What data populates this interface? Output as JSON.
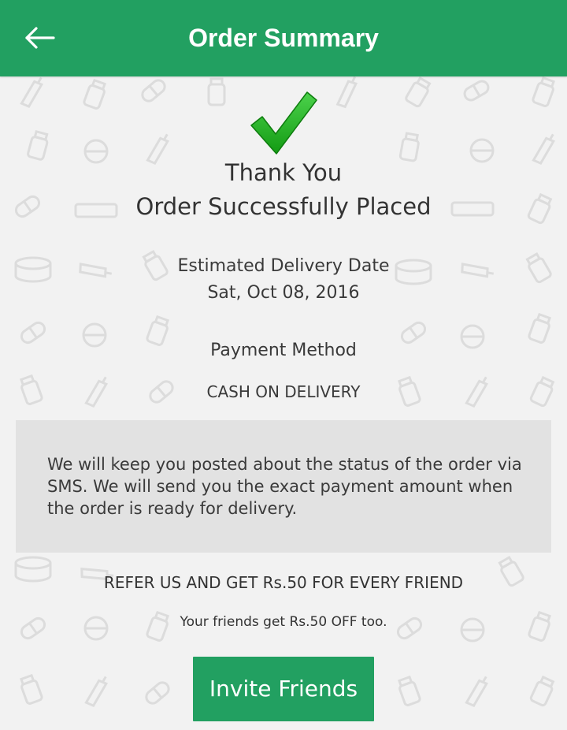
{
  "header": {
    "title": "Order Summary",
    "back_icon": "arrow-left-icon"
  },
  "confirmation": {
    "icon": "checkmark-icon",
    "thank_you": "Thank You",
    "status": "Order Successfully Placed"
  },
  "delivery": {
    "label": "Estimated Delivery Date",
    "date": "Sat, Oct 08, 2016"
  },
  "payment": {
    "label": "Payment Method",
    "method": "CASH ON DELIVERY"
  },
  "info": {
    "message": "We will keep you posted about the status of the order via SMS. We will send you the exact payment amount when the order is ready for delivery."
  },
  "referral": {
    "headline": "REFER US AND GET Rs.50 FOR EVERY FRIEND",
    "subtext": "Your friends get Rs.50 OFF too.",
    "button_label": "Invite Friends"
  },
  "colors": {
    "brand_green": "#22a061",
    "check_green": "#1fa61f",
    "background": "#f2f2f2",
    "info_box": "#e2e2e2"
  }
}
